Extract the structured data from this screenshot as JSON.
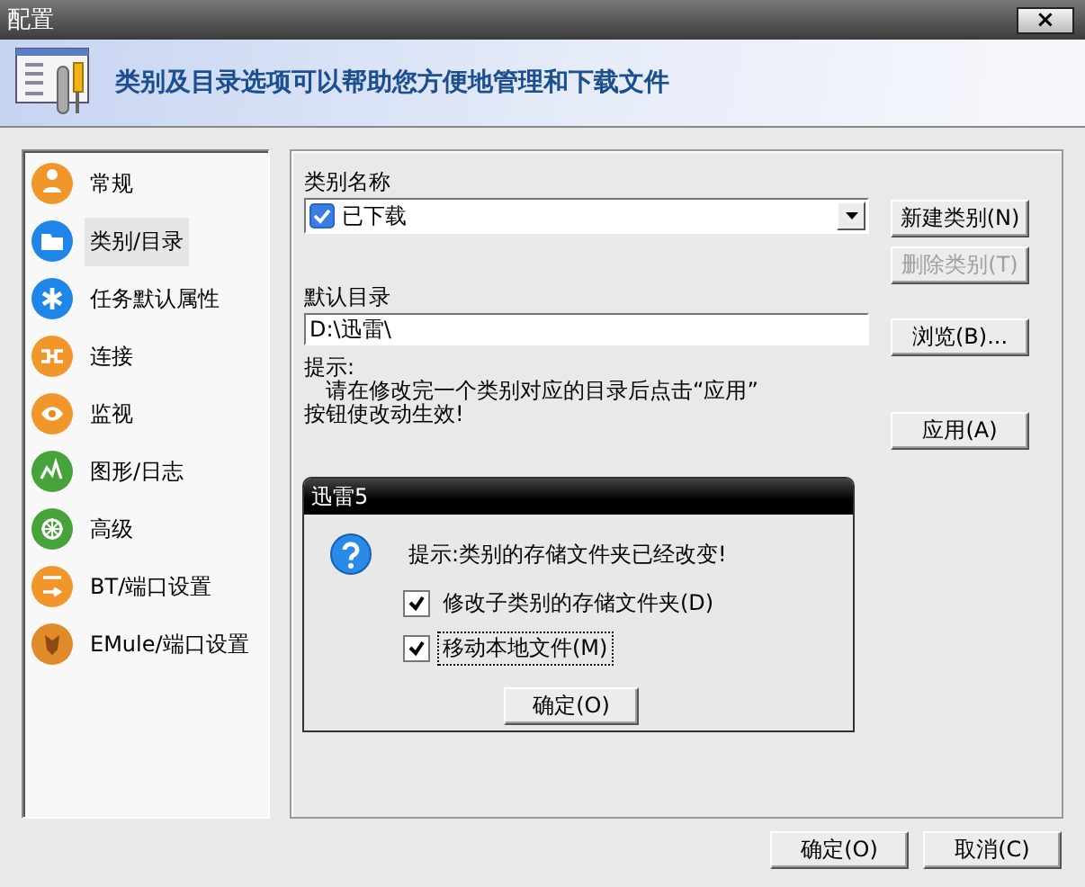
{
  "window": {
    "title": "配置",
    "close_label": "×"
  },
  "header": {
    "text": "类别及目录选项可以帮助您方便地管理和下载文件"
  },
  "sidebar": {
    "items": [
      {
        "label": "常规",
        "selected": false,
        "color": "#f0962a"
      },
      {
        "label": "类别/目录",
        "selected": true,
        "color": "#1e86e8"
      },
      {
        "label": "任务默认属性",
        "selected": false,
        "color": "#1e86e8"
      },
      {
        "label": "连接",
        "selected": false,
        "color": "#f0962a"
      },
      {
        "label": "监视",
        "selected": false,
        "color": "#f0962a"
      },
      {
        "label": "图形/日志",
        "selected": false,
        "color": "#45a33a"
      },
      {
        "label": "高级",
        "selected": false,
        "color": "#45a33a"
      },
      {
        "label": "BT/端口设置",
        "selected": false,
        "color": "#f0962a"
      },
      {
        "label": "EMule/端口设置",
        "selected": false,
        "color": "#e08a2a"
      }
    ]
  },
  "panel": {
    "category_label": "类别名称",
    "category_value": "已下载",
    "dir_label": "默认目录",
    "dir_value": "D:\\迅雷\\",
    "hint_title": "提示:",
    "hint_line1": "请在修改完一个类别对应的目录后点击“应用”",
    "hint_line2": "按钮使改动生效!",
    "buttons": [
      {
        "label": "新建类别(N)",
        "disabled": false
      },
      {
        "label": "删除类别(T)",
        "disabled": true
      },
      {
        "label": "浏览(B)...",
        "disabled": false
      },
      {
        "label": "应用(A)",
        "disabled": false
      }
    ]
  },
  "dialog": {
    "title": "迅雷5",
    "message": "提示:类别的存储文件夹已经改变!",
    "options": [
      {
        "label": "修改子类别的存储文件夹(D)",
        "checked": true,
        "focused": false
      },
      {
        "label": "移动本地文件(M)",
        "checked": true,
        "focused": true
      }
    ],
    "ok": "确定(O)"
  },
  "footer": {
    "buttons": [
      "确定(O)",
      "取消(C)"
    ]
  }
}
